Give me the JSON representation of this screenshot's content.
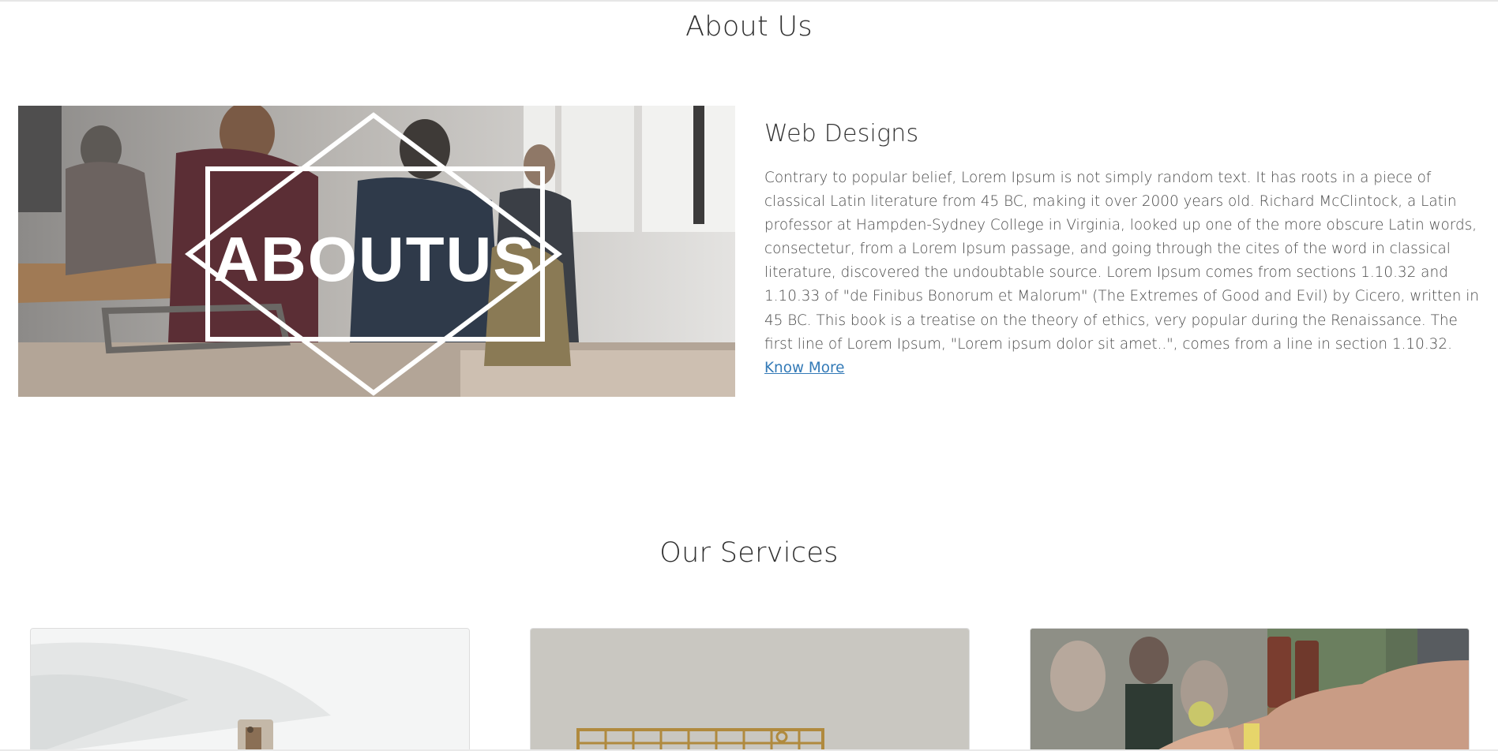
{
  "about": {
    "section_title": "About Us",
    "image_text": "ABOUTUS",
    "heading": "Web Designs",
    "body": "Contrary to popular belief, Lorem Ipsum is not simply random text. It has roots in a piece of classical Latin literature from 45 BC, making it over 2000 years old. Richard McClintock, a Latin professor at Hampden-Sydney College in Virginia, looked up one of the more obscure Latin words, consectetur, from a Lorem Ipsum passage, and going through the cites of the word in classical literature, discovered the undoubtable source. Lorem Ipsum comes from sections 1.10.32 and 1.10.33 of \"de Finibus Bonorum et Malorum\" (The Extremes of Good and Evil) by Cicero, written in 45 BC. This book is a treatise on the theory of ethics, very popular during the Renaissance. The first line of Lorem Ipsum, \"Lorem ipsum dolor sit amet..\", comes from a line in section 1.10.32.",
    "link_label": "Know More"
  },
  "services": {
    "section_title": "Our Services"
  },
  "colors": {
    "link": "#337ab7",
    "heading": "#333333",
    "body_text": "#4a4a4a"
  }
}
